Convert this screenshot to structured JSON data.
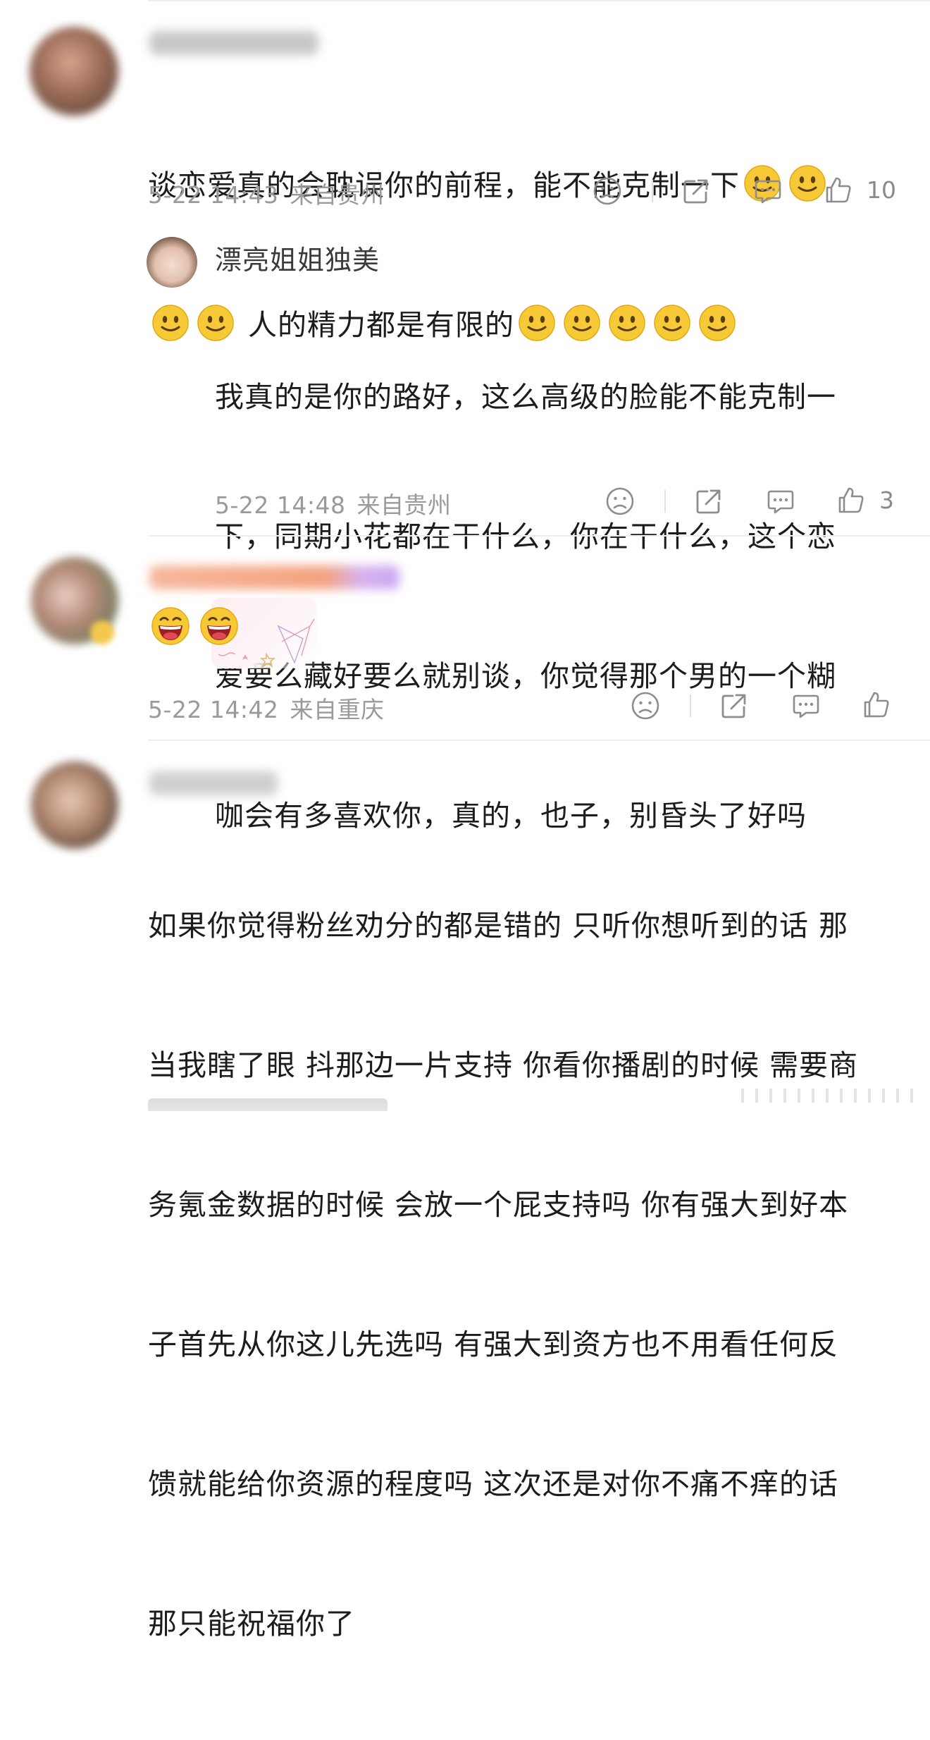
{
  "comments": [
    {
      "text_line1": "谈恋爱真的会耽误你的前程，能不能克制一下",
      "text_line2": "人的精力都是有限的",
      "time": "5-22 14:43",
      "location": "来自贵州",
      "likes": "10",
      "emojis": [
        "smile-emoji",
        "smile-emoji",
        "smile-emoji",
        "smile-emoji",
        "smile-emoji",
        "smile-emoji",
        "smile-emoji",
        "smile-emoji",
        "smile-emoji"
      ],
      "reply": {
        "username": "漂亮姐姐独美",
        "lines": [
          "我真的是你的路好，这么高级的脸能不能克制一",
          "下，同期小花都在干什么，你在干什么，这个恋",
          "爱要么藏好要么就别谈，你觉得那个男的一个糊",
          "咖会有多喜欢你，真的，也子，别昏头了好吗"
        ],
        "time": "5-22 14:48",
        "location": "来自贵州",
        "likes": "3"
      }
    },
    {
      "emojis": [
        "laugh-emoji",
        "laugh-emoji"
      ],
      "time": "5-22 14:42",
      "location": "来自重庆",
      "likes": ""
    },
    {
      "lines": [
        "如果你觉得粉丝劝分的都是错的 只听你想听到的话 那",
        "当我瞎了眼 抖那边一片支持 你看你播剧的时候 需要商",
        "务氪金数据的时候 会放一个屁支持吗 你有强大到好本",
        "子首先从你这儿先选吗 有强大到资方也不用看任何反",
        "馈就能给你资源的程度吗 这次还是对你不痛不痒的话",
        "那只能祝福你了"
      ]
    }
  ],
  "colors": {
    "meta_text": "#9a9a9a",
    "divider": "#eeeeee",
    "emoji_yellow": "#f7c531"
  }
}
